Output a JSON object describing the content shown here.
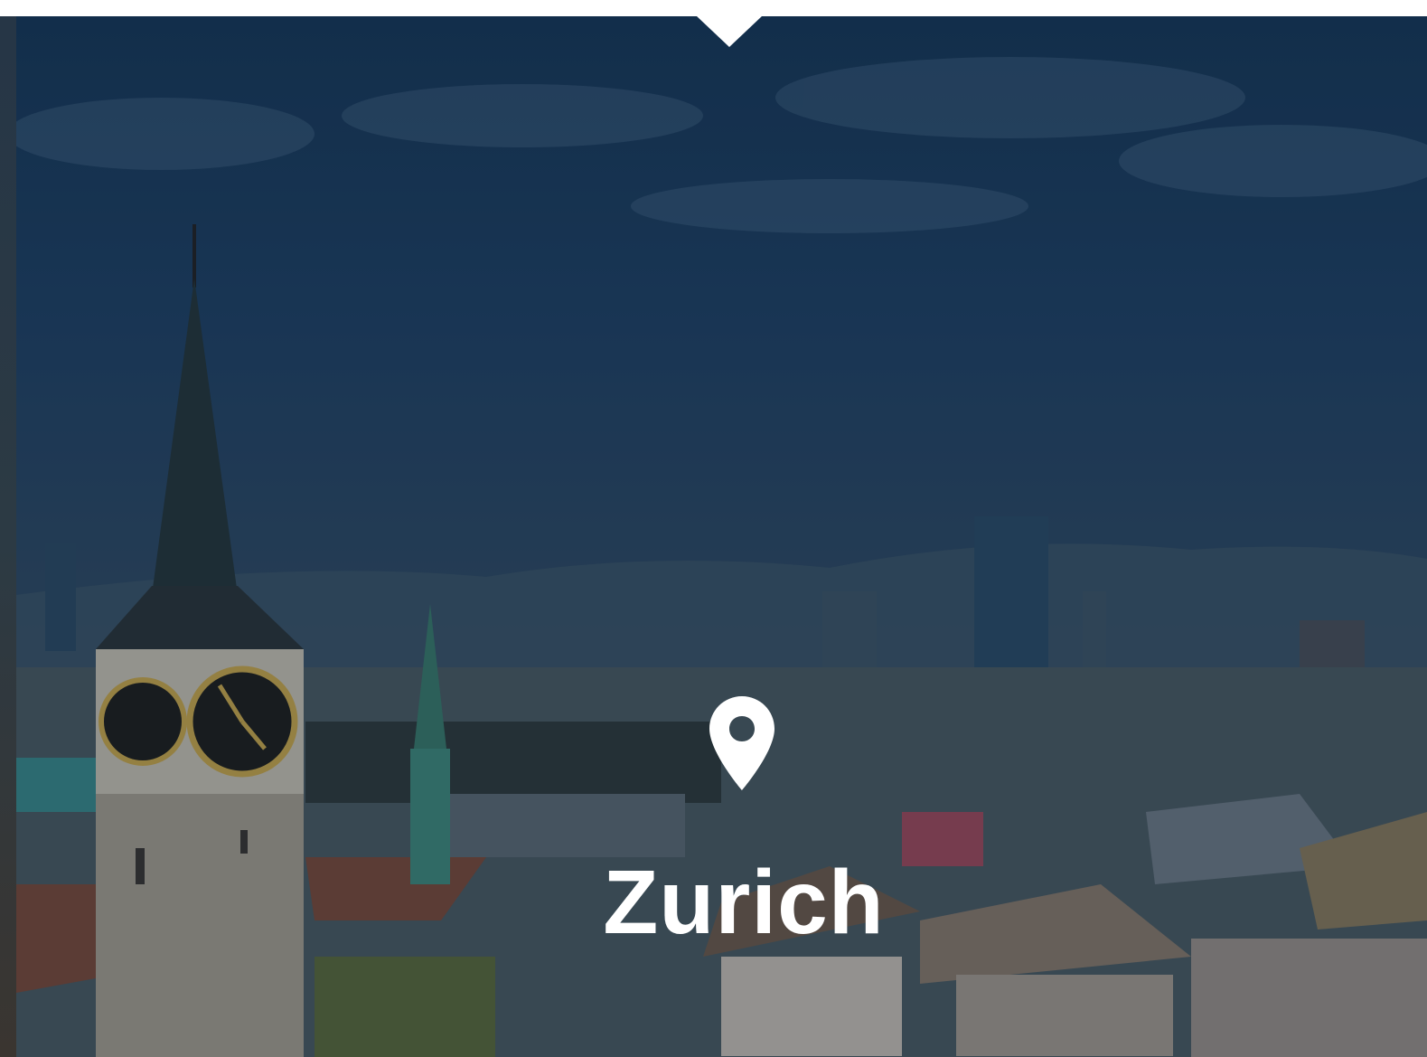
{
  "hero": {
    "city_name": "Zurich",
    "pin_icon": "location-pin-icon"
  },
  "colors": {
    "overlay": "#163756",
    "title": "#ffffff",
    "background": "#ffffff"
  }
}
